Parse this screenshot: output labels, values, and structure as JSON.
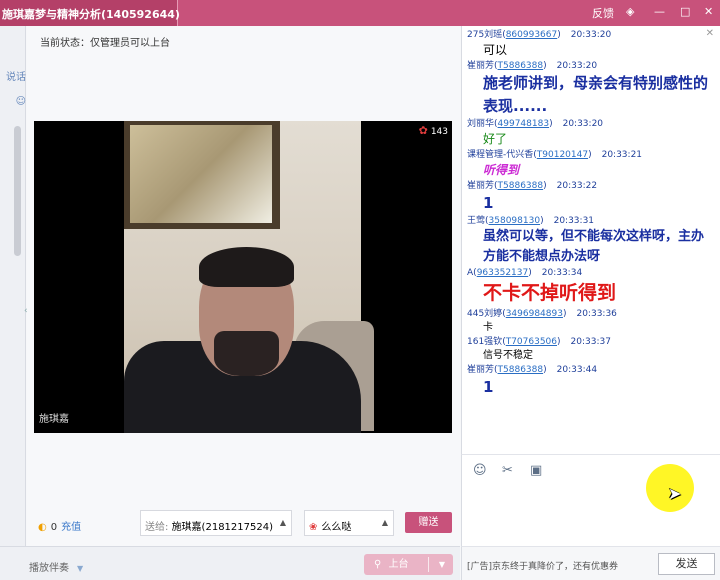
{
  "window": {
    "title": "施琪嘉梦与精神分析(140592644)",
    "controls": [
      "反馈",
      "◈",
      "—",
      "□",
      "✕"
    ]
  },
  "sidebar": {
    "items": [
      {
        "label": "说话",
        "icon": "chat-icon"
      },
      {
        "label": "",
        "icon": "user-icon"
      }
    ]
  },
  "main": {
    "status": "当前状态：仅管理员可以上台",
    "video": {
      "speaker_name": "施琪嘉",
      "viewer_count": "143"
    }
  },
  "bottom": {
    "coins": "0",
    "charge_label": "充值",
    "send_to_label": "送给:",
    "send_to_value": "施琪嘉(2181217524)",
    "gift_name": "么么哒",
    "gift_button": "赠送",
    "companion_label": "播放伴奏",
    "stage_button": "上台"
  },
  "chat": {
    "messages": [
      {
        "name": "275刘瑶",
        "qq": "860993667",
        "time": "20:33:20",
        "text": "可以",
        "color": "#000000",
        "size": "12px",
        "weight": "normal",
        "style": "normal"
      },
      {
        "name": "崔丽芳",
        "qq": "T5886388",
        "time": "20:33:20",
        "text": "施老师讲到，母亲会有特别感性的表现......",
        "color": "#1a2fa0",
        "size": "15px",
        "weight": "bold",
        "style": "normal"
      },
      {
        "name": "刘丽华",
        "qq": "499748183",
        "time": "20:33:20",
        "text": "好了",
        "color": "#1a8a1a",
        "size": "12px",
        "weight": "normal",
        "style": "normal"
      },
      {
        "name": "课程管理-代兴香",
        "qq": "T90120147",
        "time": "20:33:21",
        "text": "听得到",
        "color": "#cc2bd4",
        "size": "12px",
        "weight": "bold",
        "style": "italic"
      },
      {
        "name": "崔丽芳",
        "qq": "T5886388",
        "time": "20:33:22",
        "text": "1",
        "color": "#1a2fa0",
        "size": "15px",
        "weight": "bold",
        "style": "normal"
      },
      {
        "name": "王莺",
        "qq": "358098130",
        "time": "20:33:31",
        "text": "虽然可以等，但不能每次这样呀，主办方能不能想点办法呀",
        "color": "#1a2fa0",
        "size": "13px",
        "weight": "bold",
        "style": "normal"
      },
      {
        "name": "A",
        "qq": "963352137",
        "time": "20:33:34",
        "text": "不卡不掉听得到",
        "color": "#e01818",
        "size": "19px",
        "weight": "bold",
        "style": "normal"
      },
      {
        "name": "445刘婷",
        "qq": "3496984893",
        "time": "20:33:36",
        "text": "卡",
        "color": "#000000",
        "size": "10px",
        "weight": "normal",
        "style": "normal"
      },
      {
        "name": "161强钦",
        "qq": "T70763506",
        "time": "20:33:37",
        "text": "信号不稳定",
        "color": "#000000",
        "size": "10px",
        "weight": "normal",
        "style": "normal"
      },
      {
        "name": "崔丽芳",
        "qq": "T5886388",
        "time": "20:33:44",
        "text": "1",
        "color": "#1a2fa0",
        "size": "15px",
        "weight": "bold",
        "style": "normal"
      }
    ]
  },
  "input": {
    "tools": [
      "emoji-icon",
      "scissors-icon",
      "image-icon"
    ],
    "ad_text": "[广告]京东终于真降价了，还有优惠券",
    "send_button": "发送"
  }
}
